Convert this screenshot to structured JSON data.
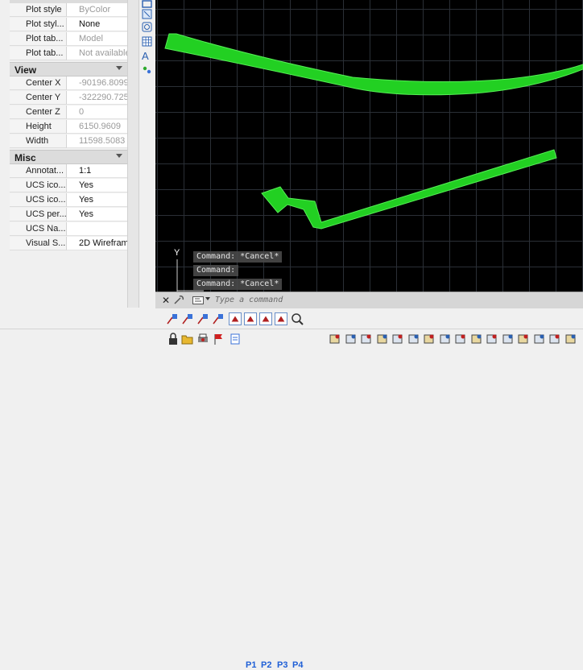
{
  "properties": {
    "top_rows": [
      {
        "name": "Plot style",
        "value": "ByColor",
        "disabled": true
      },
      {
        "name": "Plot styl...",
        "value": "None",
        "disabled": false
      },
      {
        "name": "Plot tab...",
        "value": "Model",
        "disabled": true
      },
      {
        "name": "Plot tab...",
        "value": "Not available",
        "disabled": true
      }
    ],
    "view_section": {
      "title": "View",
      "rows": [
        {
          "name": "Center X",
          "value": "-90196.8099",
          "disabled": true
        },
        {
          "name": "Center Y",
          "value": "-322290.7252",
          "disabled": true
        },
        {
          "name": "Center Z",
          "value": "0",
          "disabled": true
        },
        {
          "name": "Height",
          "value": "6150.9609",
          "disabled": true
        },
        {
          "name": "Width",
          "value": "11598.5083",
          "disabled": true
        }
      ]
    },
    "misc_section": {
      "title": "Misc",
      "rows": [
        {
          "name": "Annotat...",
          "value": "1:1",
          "disabled": false
        },
        {
          "name": "UCS ico...",
          "value": "Yes",
          "disabled": false
        },
        {
          "name": "UCS ico...",
          "value": "Yes",
          "disabled": false
        },
        {
          "name": "UCS per...",
          "value": "Yes",
          "disabled": false
        },
        {
          "name": "UCS Na...",
          "value": "",
          "disabled": false
        },
        {
          "name": "Visual S...",
          "value": "2D Wireframe",
          "disabled": false
        }
      ]
    }
  },
  "toolstrip": {
    "icons": [
      "rectangle-icon",
      "gradient-icon",
      "region-icon",
      "table-icon",
      "multiline-text-icon",
      "add-selected-icon"
    ],
    "text_glyph": "A"
  },
  "canvas": {
    "background": "#000000",
    "grid_color": "#2a2f36",
    "shape_fill": "#22d022",
    "shape_stroke": "#55ee55",
    "ucs_axis_label": "Y",
    "command_history": [
      "Command: *Cancel*",
      "Command:",
      "Command: *Cancel*"
    ]
  },
  "command_bar": {
    "close_glyph": "✕",
    "placeholder": "Type a command"
  },
  "toolbar_view": {
    "icons": [
      "view-fly-icon-1",
      "view-fly-icon-2",
      "view-fly-icon-3",
      "view-fly-icon-4",
      "view-gallery-icon-1",
      "view-gallery-icon-2",
      "view-gallery-icon-3",
      "view-gallery-icon-4",
      "zoom-icon"
    ]
  },
  "toolbar_bottom": {
    "icons_left": [
      "lock-icon",
      "open-icon",
      "print-icon",
      "flag-icon",
      "page-icon"
    ],
    "paper_labels": [
      "P1",
      "P2",
      "P3",
      "P4"
    ],
    "icons_right": [
      "render-icon-1",
      "render-icon-2",
      "render-icon-3",
      "render-icon-4",
      "render-icon-5",
      "render-icon-6",
      "render-icon-7",
      "render-icon-8",
      "render-icon-9",
      "render-icon-10",
      "render-icon-11",
      "render-icon-12",
      "render-icon-13",
      "render-icon-14",
      "render-icon-15",
      "render-icon-16"
    ]
  }
}
